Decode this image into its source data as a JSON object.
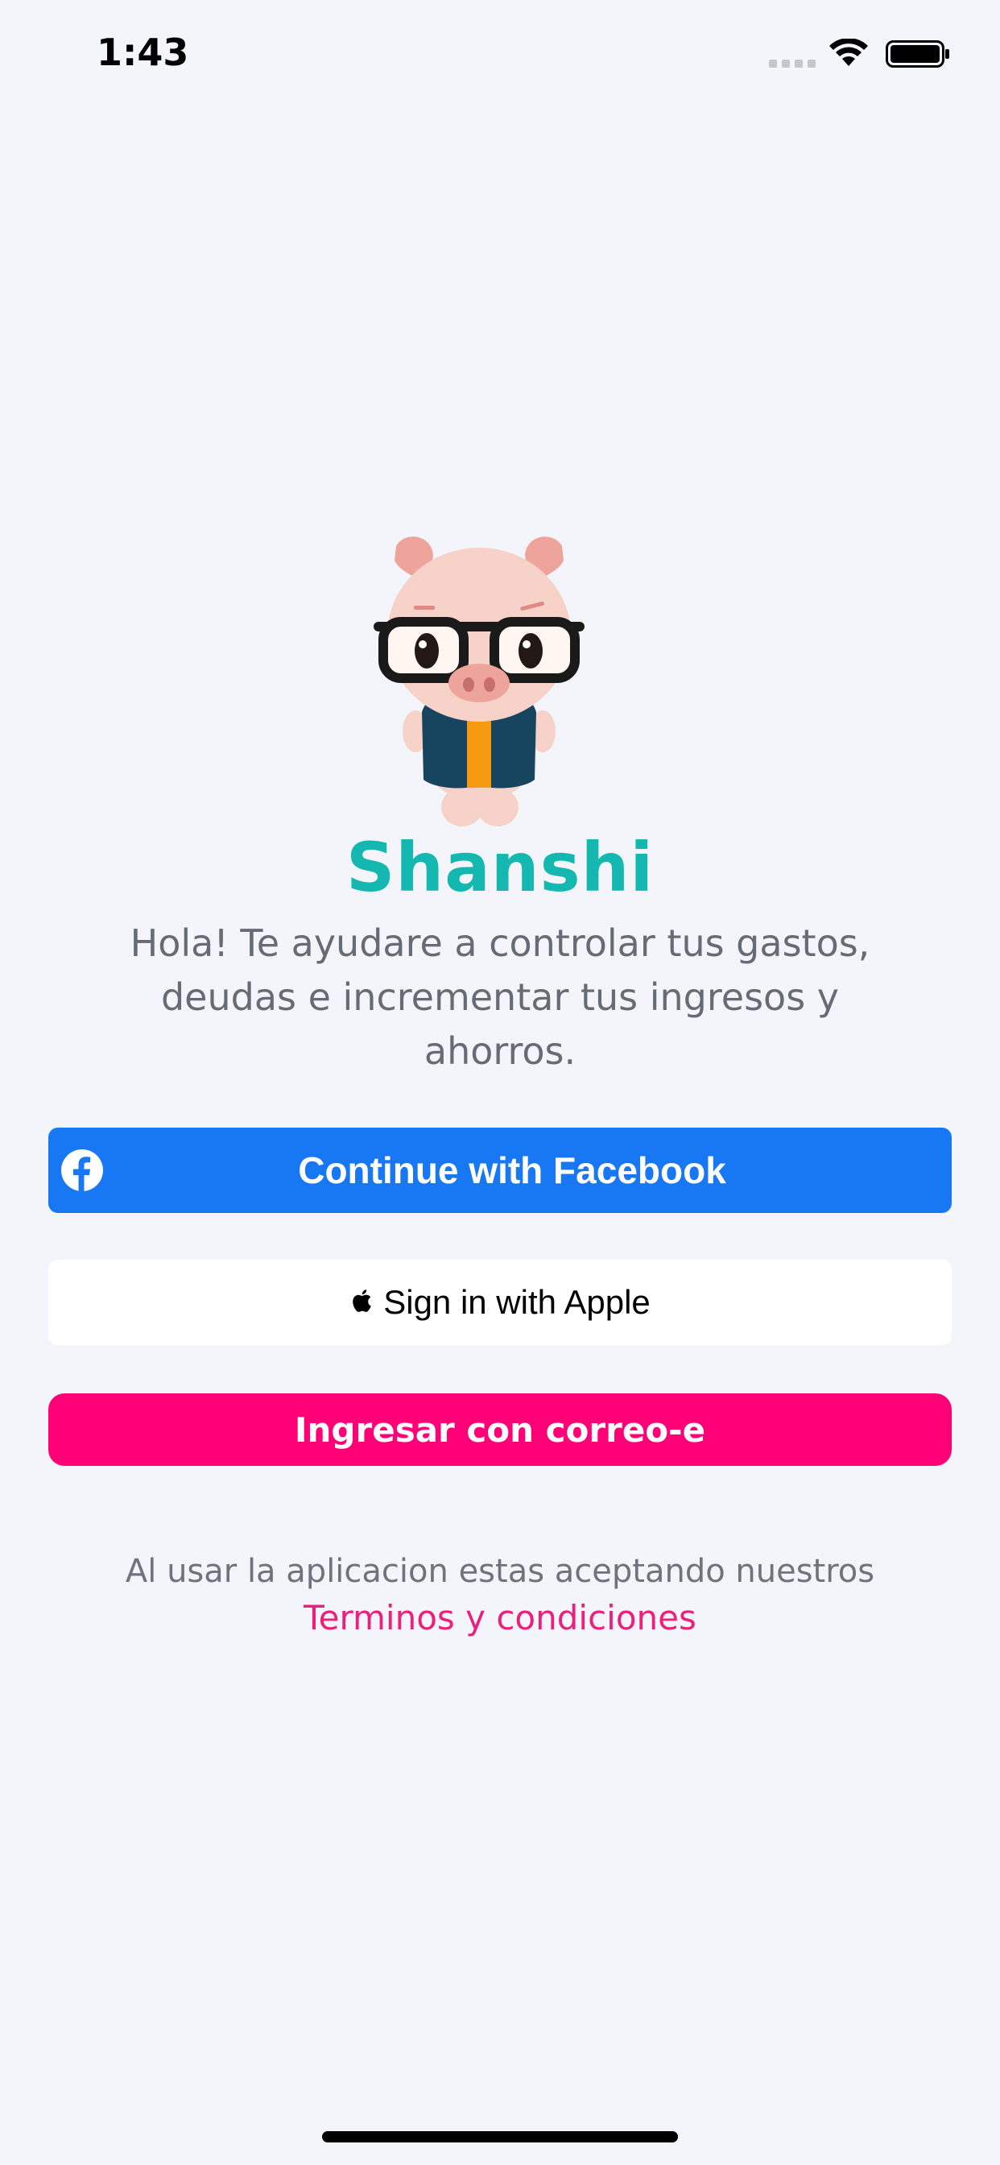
{
  "status_bar": {
    "time": "1:43",
    "signal_icon": "cellular-signal-icon",
    "wifi_icon": "wifi-icon",
    "battery_icon": "battery-icon"
  },
  "app": {
    "mascot_icon": "pig-mascot-with-glasses",
    "name": "Shanshi",
    "intro": "Hola! Te ayudare a controlar tus gastos, deudas e incrementar tus ingresos y ahorros."
  },
  "buttons": {
    "facebook_label": "Continue with Facebook",
    "facebook_icon": "facebook-icon",
    "facebook_color": "#1877f2",
    "apple_label": "Sign in with Apple",
    "apple_icon": "apple-icon",
    "email_label": "Ingresar con correo-e",
    "email_color": "#ff0077"
  },
  "terms": {
    "text": "Al usar la aplicacion estas aceptando nuestros",
    "link": "Terminos y condiciones",
    "link_color": "#ec1f7c"
  },
  "colors": {
    "background": "#f4f5fa",
    "brand_teal": "#14b8b0"
  }
}
